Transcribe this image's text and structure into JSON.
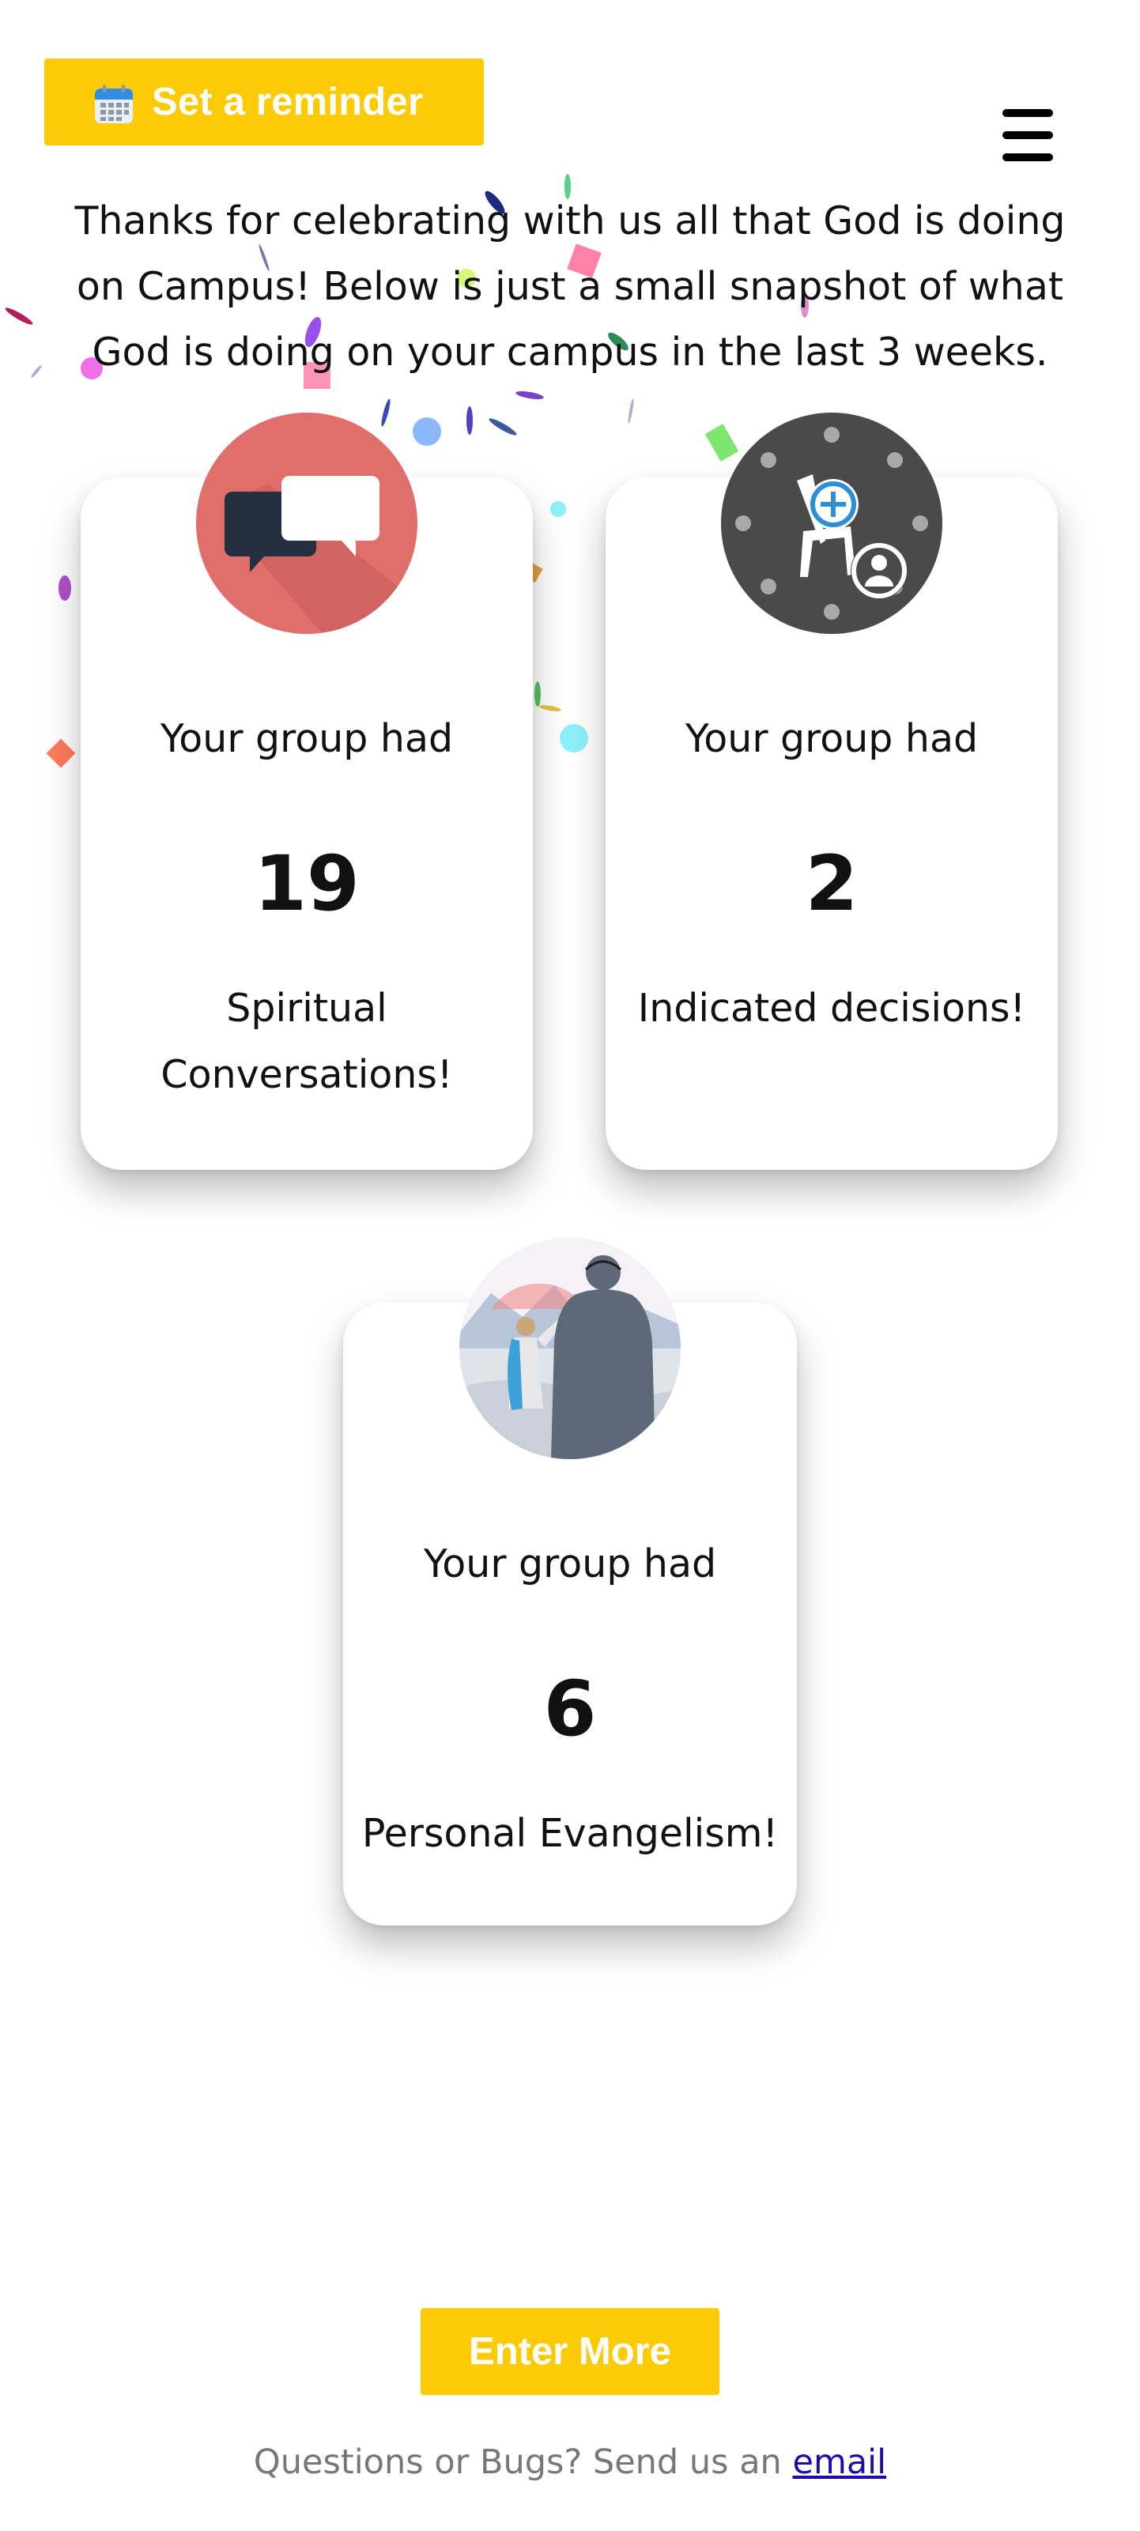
{
  "header": {
    "reminder_label": "Set a reminder",
    "calendar_icon": "calendar-icon",
    "menu_icon": "hamburger-menu-icon"
  },
  "intro_text": "Thanks for celebrating with us all that God is doing on Campus! Below is just a small snapshot of what God is doing on your campus in the last 3 weeks.",
  "stats": [
    {
      "lead": "Your group had",
      "value": "19",
      "label": "Spiritual Conversations!",
      "icon": "chat-bubbles-icon"
    },
    {
      "lead": "Your group had",
      "value": "2",
      "label": "Indicated decisions!",
      "icon": "decision-chair-icon"
    },
    {
      "lead": "Your group had",
      "value": "6",
      "label": "Personal Evangelism!",
      "icon": "jesus-person-illustration"
    }
  ],
  "enter_label": "Enter More",
  "footer": {
    "text": "Questions or Bugs? Send us an",
    "link": "email"
  },
  "colors": {
    "accent": "#fdca07",
    "chat_circle": "#e06f6c",
    "decision_circle": "#4a4a4a",
    "link": "#1a0dab"
  }
}
